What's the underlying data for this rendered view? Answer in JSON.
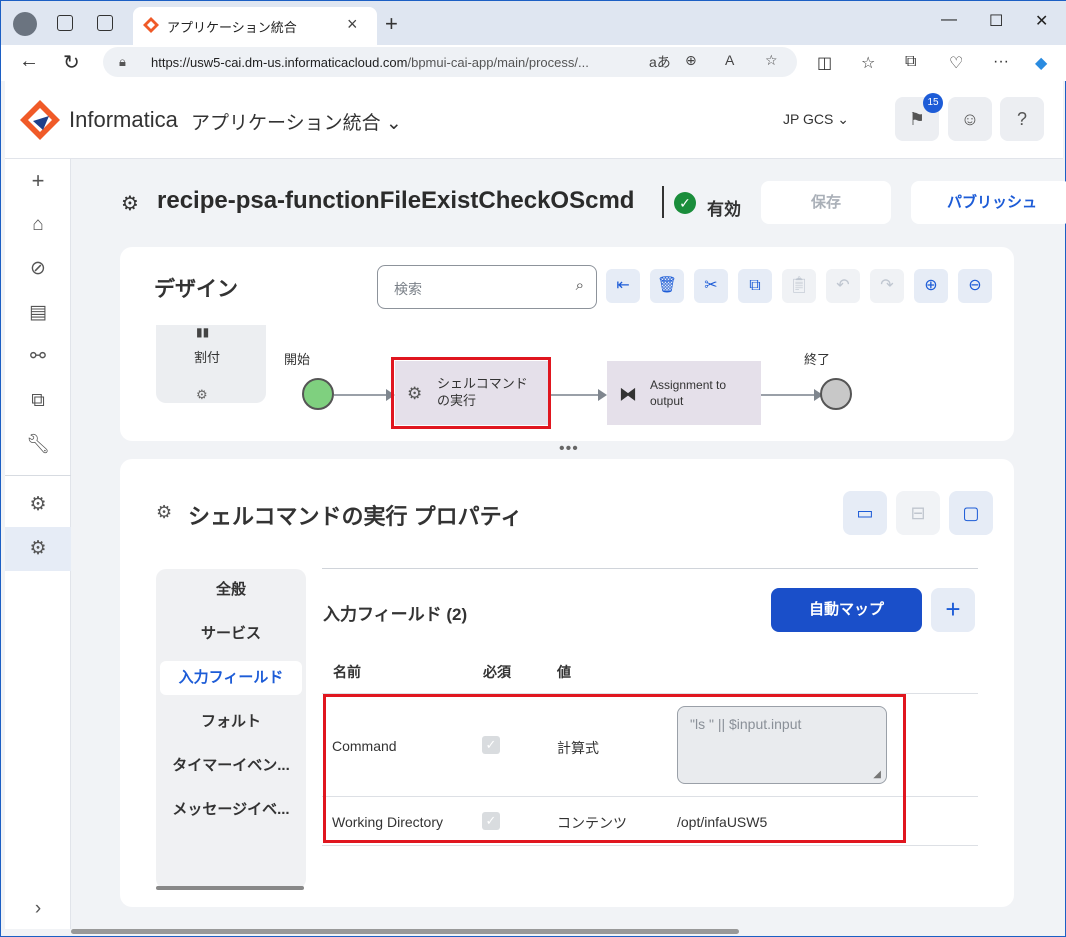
{
  "browser": {
    "tab_title": "アプリケーション統合",
    "url_host": "https://usw5-cai.dm-us.informaticacloud.com",
    "url_path": "/bpmui-cai-app/main/process/..."
  },
  "header": {
    "brand": "Informatica",
    "app_name": "アプリケーション統合",
    "org": "JP GCS",
    "notification_count": "15",
    "help_label": "?"
  },
  "process": {
    "title": "recipe-psa-functionFileExistCheckOScmd",
    "status": "有効",
    "save_label": "保存",
    "publish_label": "パブリッシュ"
  },
  "design": {
    "title": "デザイン",
    "search_placeholder": "検索",
    "palette_label": "割付",
    "nodes": {
      "start": "開始",
      "shell": "シェルコマンドの実行",
      "shell_line1": "シェルコマンド",
      "shell_line2": "の実行",
      "assign_line1": "Assignment to",
      "assign_line2": "output",
      "end": "終了"
    }
  },
  "properties": {
    "title": "シェルコマンドの実行 プロパティ",
    "tabs": [
      "全般",
      "サービス",
      "入力フィールド",
      "フォルト",
      "タイマーイベン...",
      "メッセージイベ..."
    ],
    "active_tab": "入力フィールド",
    "fields_title": "入力フィールド (2)",
    "automap_label": "自動マップ",
    "columns": {
      "name": "名前",
      "required": "必須",
      "value": "値"
    },
    "rows": [
      {
        "name": "Command",
        "required": true,
        "type": "計算式",
        "value": "\"ls \" || $input.input"
      },
      {
        "name": "Working Directory",
        "required": true,
        "type": "コンテンツ",
        "value": "/opt/infaUSW5"
      }
    ]
  },
  "colors": {
    "accent": "#1d5cd7",
    "highlight": "#e0161f",
    "status_ok": "#1a8d3b",
    "step_fill": "#e5e0ea",
    "start_node": "#7fd07f"
  }
}
